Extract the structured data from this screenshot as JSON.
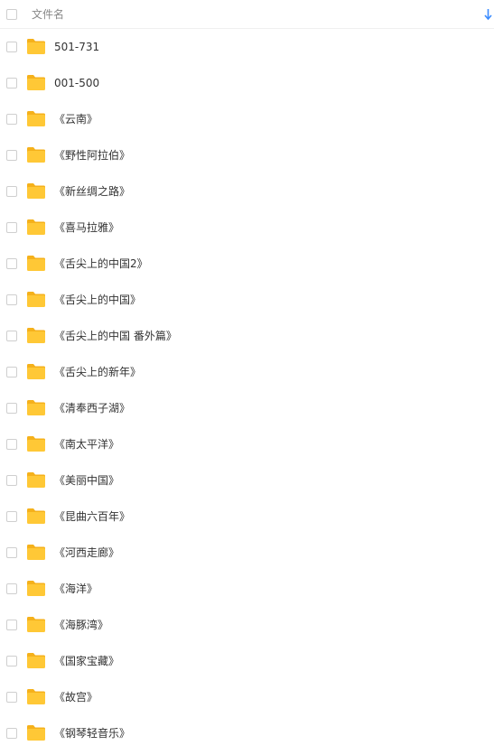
{
  "header": {
    "column_label": "文件名",
    "sort_icon": "sort-down-arrow-icon"
  },
  "colors": {
    "accent": "#3b8cff",
    "folder": "#ffc836",
    "folder_tab": "#f5b11b"
  },
  "items": [
    {
      "name": "501-731",
      "icon": "folder-icon"
    },
    {
      "name": "001-500",
      "icon": "folder-icon"
    },
    {
      "name": "《云南》",
      "icon": "folder-icon"
    },
    {
      "name": "《野性阿拉伯》",
      "icon": "folder-icon"
    },
    {
      "name": "《新丝绸之路》",
      "icon": "folder-icon"
    },
    {
      "name": "《喜马拉雅》",
      "icon": "folder-icon"
    },
    {
      "name": "《舌尖上的中国2》",
      "icon": "folder-icon"
    },
    {
      "name": "《舌尖上的中国》",
      "icon": "folder-icon"
    },
    {
      "name": "《舌尖上的中国 番外篇》",
      "icon": "folder-icon"
    },
    {
      "name": "《舌尖上的新年》",
      "icon": "folder-icon"
    },
    {
      "name": "《清奉西子湖》",
      "icon": "folder-icon"
    },
    {
      "name": "《南太平洋》",
      "icon": "folder-icon"
    },
    {
      "name": "《美丽中国》",
      "icon": "folder-icon"
    },
    {
      "name": "《昆曲六百年》",
      "icon": "folder-icon"
    },
    {
      "name": "《河西走廊》",
      "icon": "folder-icon"
    },
    {
      "name": "《海洋》",
      "icon": "folder-icon"
    },
    {
      "name": "《海豚湾》",
      "icon": "folder-icon"
    },
    {
      "name": "《国家宝藏》",
      "icon": "folder-icon"
    },
    {
      "name": "《故宫》",
      "icon": "folder-icon"
    },
    {
      "name": "《钢琴轻音乐》",
      "icon": "folder-icon"
    }
  ]
}
